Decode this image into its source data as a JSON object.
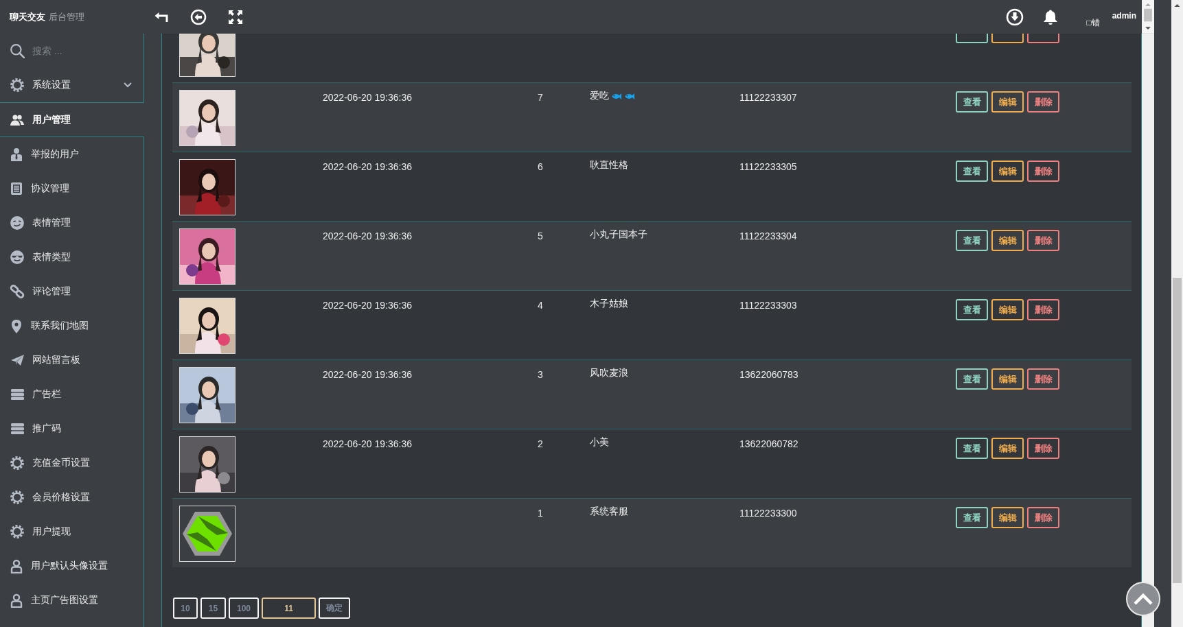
{
  "header": {
    "brand": "聊天交友",
    "subtitle": "后台管理",
    "notice": "□错",
    "user": "admin"
  },
  "sidebar": {
    "search": {
      "placeholder": "搜索 ..."
    },
    "settings": {
      "label": "系统设置",
      "expanded": false
    },
    "current": {
      "label": "用户管理",
      "selected": true
    },
    "items": [
      {
        "label": "举报的用户",
        "selected": false
      },
      {
        "label": "协议管理",
        "selected": false
      },
      {
        "label": "表情管理",
        "selected": false
      },
      {
        "label": "表情类型",
        "selected": false
      },
      {
        "label": "评论管理",
        "selected": false
      },
      {
        "label": "联系我们地图",
        "selected": false
      },
      {
        "label": "网站留言板",
        "selected": false
      },
      {
        "label": "广告栏",
        "selected": false
      },
      {
        "label": "推广码",
        "selected": false
      },
      {
        "label": "充值金币设置",
        "selected": false
      },
      {
        "label": "会员价格设置",
        "selected": false
      },
      {
        "label": "用户提现",
        "selected": false
      },
      {
        "label": "用户默认头像设置",
        "selected": false
      },
      {
        "label": "主页广告图设置",
        "selected": false
      }
    ]
  },
  "table": {
    "rows": [
      {
        "avatar": {
          "kind": "picture"
        },
        "actions": [
          {
            "kind": "view"
          },
          {
            "kind": "edit"
          },
          {
            "kind": "delete"
          }
        ]
      },
      {
        "avatar": {
          "kind": "picture"
        },
        "created": "2022-06-20 19:36:36",
        "id": "7",
        "name": "爱吃",
        "badges": [
          {
            "kind": "fish"
          },
          {
            "kind": "fish"
          }
        ],
        "phone": "11122233307",
        "actions": [
          {
            "kind": "view",
            "label": "查看"
          },
          {
            "kind": "edit",
            "label": "编辑"
          },
          {
            "kind": "delete",
            "label": "删除"
          }
        ]
      },
      {
        "avatar": {
          "kind": "picture"
        },
        "created": "2022-06-20 19:36:36",
        "id": "6",
        "name": "耿直性格",
        "phone": "11122233305",
        "actions": [
          {
            "kind": "view",
            "label": "查看"
          },
          {
            "kind": "edit",
            "label": "编辑"
          },
          {
            "kind": "delete",
            "label": "删除"
          }
        ]
      },
      {
        "avatar": {
          "kind": "picture"
        },
        "created": "2022-06-20 19:36:36",
        "id": "5",
        "name": "小丸子国本子",
        "phone": "11122233304",
        "actions": [
          {
            "kind": "view",
            "label": "查看"
          },
          {
            "kind": "edit",
            "label": "编辑"
          },
          {
            "kind": "delete",
            "label": "删除"
          }
        ]
      },
      {
        "avatar": {
          "kind": "picture"
        },
        "created": "2022-06-20 19:36:36",
        "id": "4",
        "name": "木子姑娘",
        "phone": "11122233303",
        "actions": [
          {
            "kind": "view",
            "label": "查看"
          },
          {
            "kind": "edit",
            "label": "编辑"
          },
          {
            "kind": "delete",
            "label": "删除"
          }
        ]
      },
      {
        "avatar": {
          "kind": "picture"
        },
        "created": "2022-06-20 19:36:36",
        "id": "3",
        "name": "风吹麦浪",
        "phone": "13622060783",
        "actions": [
          {
            "kind": "view",
            "label": "查看"
          },
          {
            "kind": "edit",
            "label": "编辑"
          },
          {
            "kind": "delete",
            "label": "删除"
          }
        ]
      },
      {
        "avatar": {
          "kind": "picture"
        },
        "created": "2022-06-20 19:36:36",
        "id": "2",
        "name": "小美",
        "phone": "13622060782",
        "actions": [
          {
            "kind": "view",
            "label": "查看"
          },
          {
            "kind": "edit",
            "label": "编辑"
          },
          {
            "kind": "delete",
            "label": "删除"
          }
        ]
      },
      {
        "avatar": {
          "kind": "logo"
        },
        "id": "1",
        "name": "系统客服",
        "phone": "11122233300",
        "actions": [
          {
            "kind": "view",
            "label": "查看"
          },
          {
            "kind": "edit",
            "label": "编辑"
          },
          {
            "kind": "delete",
            "label": "删除"
          }
        ]
      }
    ]
  },
  "pager": {
    "sizes": [
      {
        "label": "10"
      },
      {
        "label": "15"
      },
      {
        "label": "100"
      }
    ],
    "page_input": {
      "value": "11"
    },
    "confirm": "确定"
  }
}
